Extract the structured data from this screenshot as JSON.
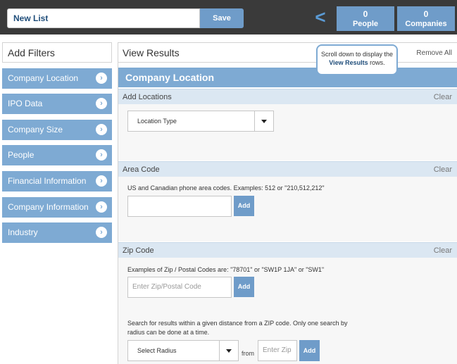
{
  "topbar": {
    "list_name": "New List",
    "save_label": "Save",
    "people_count": "0",
    "people_label": "People",
    "companies_count": "0",
    "companies_label": "Companies"
  },
  "sidebar": {
    "title": "Add Filters",
    "items": [
      {
        "label": "Company Location"
      },
      {
        "label": "IPO Data"
      },
      {
        "label": "Company Size"
      },
      {
        "label": "People"
      },
      {
        "label": "Financial Information"
      },
      {
        "label": "Company Information"
      },
      {
        "label": "Industry"
      }
    ]
  },
  "main": {
    "title": "View Results",
    "remove_all": "Remove All",
    "tooltip": {
      "prefix": "Scroll down to display the",
      "strong": "View Results",
      "suffix": "rows."
    },
    "section_title": "Company Location",
    "add_locations": {
      "title": "Add Locations",
      "clear": "Clear",
      "select_label": "Location Type"
    },
    "area_code": {
      "title": "Area Code",
      "clear": "Clear",
      "hint": "US and Canadian phone area codes. Examples: 512 or \"210,512,212\"",
      "input_value": "",
      "add_label": "Add"
    },
    "zip_code": {
      "title": "Zip Code",
      "clear": "Clear",
      "hint": "Examples of Zip / Postal Codes are: \"78701\" or \"SW1P 1JA\" or \"SW1\"",
      "placeholder": "Enter Zip/Postal Code",
      "add_label": "Add",
      "radius_hint_line1": "Search for results within a given distance from a ZIP code. Only one search by",
      "radius_hint_line2": "radius can be done at a time.",
      "radius_select_label": "Select Radius",
      "from_label": "from",
      "radius_zip_placeholder": "Enter Zip",
      "radius_add_label": "Add"
    }
  },
  "colors": {
    "accent": "#7eaad3",
    "button": "#6f9cc9",
    "topbar": "#3a3a3a",
    "subhead": "#dbe7f2"
  }
}
